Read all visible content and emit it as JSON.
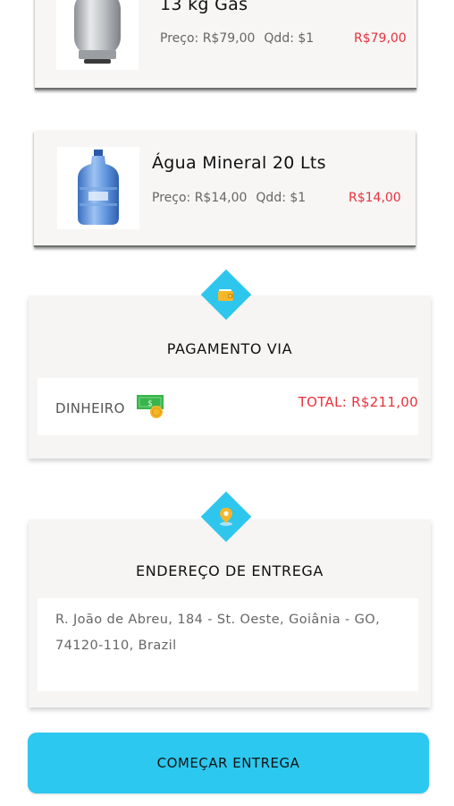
{
  "products": [
    {
      "name": "13 kg Gás",
      "price_label": "Preço: R$79,00",
      "qty_label": "Qdd: $1",
      "subtotal": "R$79,00",
      "icon": "gas-cylinder-icon"
    },
    {
      "name": "Água Mineral 20 Lts",
      "price_label": "Preço: R$14,00",
      "qty_label": "Qdd: $1",
      "subtotal": "R$14,00",
      "icon": "water-jug-icon"
    }
  ],
  "payment": {
    "icon": "wallet-icon",
    "title": "PAGAMENTO VIA",
    "method": "DINHEIRO",
    "method_icon": "cash-icon",
    "total": "TOTAL: R$211,00"
  },
  "delivery": {
    "icon": "location-pin-icon",
    "title": "ENDEREÇO DE ENTREGA",
    "address": "R. João de Abreu, 184 - St. Oeste, Goiânia - GO, 74120-110, Brazil"
  },
  "actions": {
    "start_delivery_label": "COMEÇAR ENTREGA"
  },
  "colors": {
    "accent": "#2cc8ef",
    "price_red": "#e8323c",
    "card_bg": "#f6f5f4"
  }
}
